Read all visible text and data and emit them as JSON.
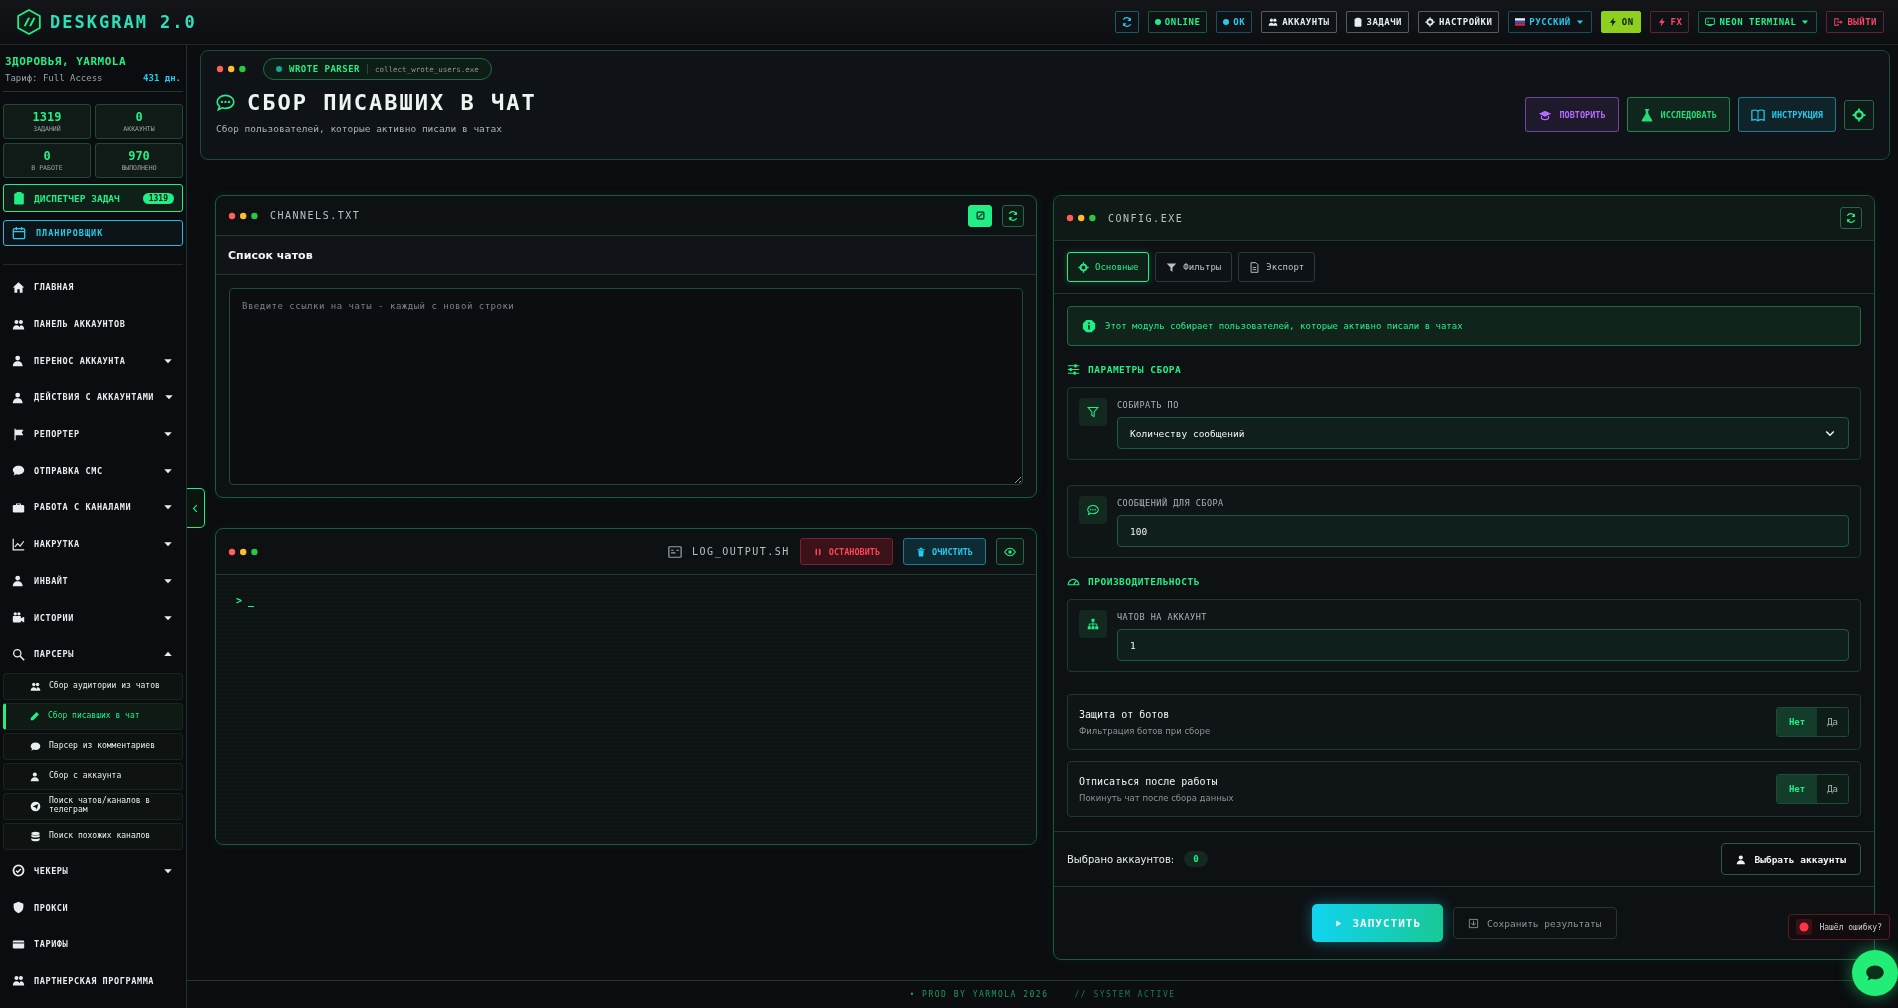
{
  "app": {
    "logo_text": "DESKGRAM 2.0"
  },
  "topbar": {
    "items": [
      {
        "label": "ONLINE",
        "kind": "status",
        "color": "#22ee88"
      },
      {
        "label": "OK",
        "kind": "status",
        "color": "#22ccee"
      },
      {
        "label": "АККАУНТЫ",
        "kind": "button",
        "color": "#e6ecef"
      },
      {
        "label": "ЗАДАЧИ",
        "kind": "button",
        "color": "#e6ecef"
      },
      {
        "label": "НАСТРОЙКИ",
        "kind": "button",
        "color": "#e6ecef"
      },
      {
        "label": "РУССКИЙ",
        "kind": "dropdown",
        "color": "#22ccee"
      },
      {
        "label": "ON",
        "kind": "toggle",
        "on": true,
        "color": "#8fcf1f"
      },
      {
        "label": "FX",
        "kind": "button",
        "color": "#ff4466"
      },
      {
        "label": "NEON TERMINAL",
        "kind": "dropdown",
        "color": "#22ee88"
      },
      {
        "label": "ВЫЙТИ",
        "kind": "button",
        "color": "#ff4466"
      }
    ]
  },
  "user": {
    "name": "ЗДОРОВЬЯ, YARMOLA",
    "plan": "Тариф: Full Access",
    "days": "431 дн."
  },
  "stats": [
    {
      "value": "1319",
      "label": "ЗАДАНИЙ"
    },
    {
      "value": "0",
      "label": "АККАУНТЫ"
    },
    {
      "value": "0",
      "label": "В РАБОТЕ"
    },
    {
      "value": "970",
      "label": "ВЫПОЛНЕНО"
    }
  ],
  "task_manager": {
    "label": "ДИСПЕТЧЕР ЗАДАЧ",
    "badge": "1319"
  },
  "scheduler": {
    "label": "ПЛАНИРОВЩИК"
  },
  "nav": [
    {
      "label": "ГЛАВНАЯ"
    },
    {
      "label": "ПАНЕЛЬ АККАУНТОВ"
    },
    {
      "label": "ПЕРЕНОС АККАУНТА",
      "expanded": false
    },
    {
      "label": "ДЕЙСТВИЯ С АККАУНТАМИ",
      "expanded": false
    },
    {
      "label": "РЕПОРТЕР",
      "expanded": false
    },
    {
      "label": "ОТПРАВКА СМС",
      "expanded": false
    },
    {
      "label": "РАБОТА С КАНАЛАМИ",
      "expanded": false
    },
    {
      "label": "НАКРУТКА",
      "expanded": false
    },
    {
      "label": "ИНВАЙТ",
      "expanded": false
    },
    {
      "label": "ИСТОРИИ",
      "expanded": false
    },
    {
      "label": "ПАРСЕРЫ",
      "expanded": true,
      "children": [
        {
          "label": "Сбор аудитории из чатов",
          "selected": false
        },
        {
          "label": "Сбор писавших в чат",
          "selected": true
        },
        {
          "label": "Парсер из комментариев",
          "selected": false
        },
        {
          "label": "Сбор с аккаунта",
          "selected": false
        },
        {
          "label": "Поиск чатов/каналов в телеграм",
          "selected": false
        },
        {
          "label": "Поиск похожих каналов",
          "selected": false
        }
      ]
    },
    {
      "label": "ЧЕКЕРЫ",
      "expanded": false
    },
    {
      "label": "ПРОКСИ"
    },
    {
      "label": "ТАРИФЫ"
    },
    {
      "label": "ПАРТНЕРСКАЯ ПРОГРАММА"
    }
  ],
  "module": {
    "tag": "WROTE PARSER",
    "file": "collect_wrote_users.exe",
    "title": "СБОР ПИСАВШИХ В ЧАТ",
    "subtitle": "Сбор пользователей, которые активно писали в чатах",
    "actions": [
      {
        "label": "ПОВТОРИТЬ",
        "color": "#b46cff"
      },
      {
        "label": "ИССЛЕДОВАТЬ",
        "color": "#22dd77"
      },
      {
        "label": "ИНСТРУКЦИЯ",
        "color": "#22ccee"
      }
    ]
  },
  "channels_panel": {
    "file": "CHANNELS.TXT",
    "heading": "Список чатов",
    "placeholder": "Введите ссылки на чаты - каждый с новой строки"
  },
  "log_panel": {
    "file": "LOG_OUTPUT.SH",
    "stop": "ОСТАНОВИТЬ",
    "clear": "ОЧИСТИТЬ",
    "prompt": "> _"
  },
  "config": {
    "file": "CONFIG.EXE",
    "tabs": [
      {
        "label": "Основные",
        "selected": true
      },
      {
        "label": "Фильтры",
        "selected": false
      },
      {
        "label": "Экспорт",
        "selected": false
      }
    ],
    "info": "Этот модуль собирает пользователей, которые активно писали в чатах",
    "sections": [
      {
        "title": "ПАРАМЕТРЫ СБОРА",
        "fields": [
          {
            "kind": "select",
            "label": "СОБИРАТЬ ПО",
            "value": "Количеству сообщений"
          },
          {
            "kind": "input",
            "label": "СООБЩЕНИЙ ДЛЯ СБОРА",
            "value": "100"
          }
        ]
      },
      {
        "title": "ПРОИЗВОДИТЕЛЬНОСТЬ",
        "fields": [
          {
            "kind": "input",
            "label": "ЧАТОВ НА АККАУНТ",
            "value": "1"
          }
        ]
      }
    ],
    "toggles": [
      {
        "title": "Защита от ботов",
        "hint": "Фильтрация ботов при сборе",
        "options": [
          {
            "label": "Нет",
            "selected": true
          },
          {
            "label": "Да",
            "selected": false
          }
        ]
      },
      {
        "title": "Отписаться после работы",
        "hint": "Покинуть чат после сбора данных",
        "options": [
          {
            "label": "Нет",
            "selected": true
          },
          {
            "label": "Да",
            "selected": false
          }
        ]
      }
    ],
    "selected_accounts": {
      "label": "Выбрано аккаунтов:",
      "count": "0"
    },
    "choose_button": "Выбрать аккаунты",
    "run_button": "ЗАПУСТИТЬ",
    "save_button": "Сохранить результаты"
  },
  "footer": {
    "credit": "• PROD BY YARMOLA 2026",
    "status": "// SYSTEM ACTIVE"
  },
  "bug_report": "Нашёл ошибку?"
}
